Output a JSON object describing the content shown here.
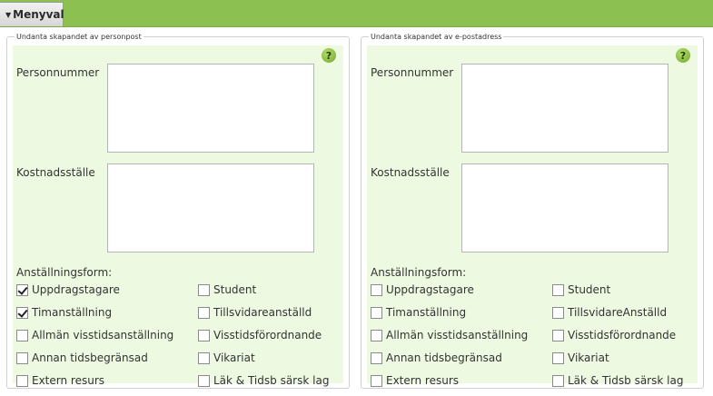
{
  "menu": {
    "label": "Menyval"
  },
  "panels": [
    {
      "title": "Undanta skapandet av personpost",
      "personnummer_label": "Personnummer",
      "kostnadsstalle_label": "Kostnadsställe",
      "form_label": "Anställningsform:",
      "options": [
        {
          "label": "Uppdragstagare",
          "checked": true
        },
        {
          "label": "Timanställning",
          "checked": true
        },
        {
          "label": "Allmän visstidsanställning",
          "checked": false
        },
        {
          "label": "Annan tidsbegränsad",
          "checked": false
        },
        {
          "label": "Extern resurs",
          "checked": false
        },
        {
          "label": "Student",
          "checked": false
        },
        {
          "label": "Tillsvidareanställd",
          "checked": false
        },
        {
          "label": "Visstidsförordnande",
          "checked": false
        },
        {
          "label": "Vikariat",
          "checked": false
        },
        {
          "label": "Läk & Tidsb särsk lag",
          "checked": false
        }
      ]
    },
    {
      "title": "Undanta skapandet av e-postadress",
      "personnummer_label": "Personnummer",
      "kostnadsstalle_label": "Kostnadsställe",
      "form_label": "Anställningsform:",
      "options": [
        {
          "label": "Uppdragstagare",
          "checked": false
        },
        {
          "label": "Timanställning",
          "checked": false
        },
        {
          "label": "Allmän visstidsanställning",
          "checked": false
        },
        {
          "label": "Annan tidsbegränsad",
          "checked": false
        },
        {
          "label": "Extern resurs",
          "checked": false
        },
        {
          "label": "Student",
          "checked": false
        },
        {
          "label": "TillsvidareAnställd",
          "checked": false
        },
        {
          "label": "Visstidsförordnande",
          "checked": false
        },
        {
          "label": "Vikariat",
          "checked": false
        },
        {
          "label": "Läk & Tidsb särsk lag",
          "checked": false
        }
      ]
    }
  ],
  "help_icon": "?"
}
